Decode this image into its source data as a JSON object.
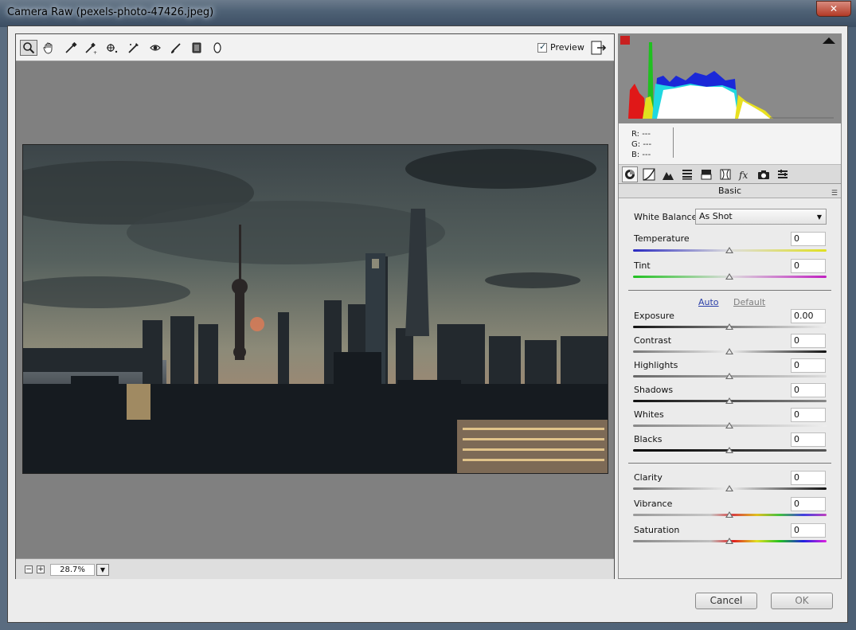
{
  "window": {
    "title": "Camera Raw (pexels-photo-47426.jpeg)",
    "close_glyph": "✕"
  },
  "toolbar": {
    "tools": [
      "zoom-icon",
      "hand-icon",
      "white-balance-icon",
      "color-sampler-icon",
      "targeted-adjust-icon",
      "crop-icon",
      "red-eye-icon",
      "brush-icon",
      "graduated-filter-icon",
      "radial-filter-icon"
    ],
    "preview_label": "Preview",
    "preview_checked": true
  },
  "zoom": {
    "minus": "−",
    "plus": "+",
    "value": "28.7%",
    "dropdown": "▼"
  },
  "readout": {
    "r_label": "R:",
    "r_value": "---",
    "g_label": "G:",
    "g_value": "---",
    "b_label": "B:",
    "b_value": "---"
  },
  "panel": {
    "tabs": [
      "basic-icon",
      "tone-curve-icon",
      "detail-icon",
      "hsl-icon",
      "split-toning-icon",
      "lens-icon",
      "fx-icon",
      "camera-calibration-icon",
      "presets-icon"
    ],
    "header": "Basic",
    "menu_glyph": "☰",
    "white_balance_label": "White Balance:",
    "white_balance_value": "As Shot",
    "auto_label": "Auto",
    "default_label": "Default",
    "sliders": [
      {
        "label": "Temperature",
        "value": "0",
        "position": 0.5
      },
      {
        "label": "Tint",
        "value": "0",
        "position": 0.5
      },
      {
        "label": "Exposure",
        "value": "0.00",
        "position": 0.5
      },
      {
        "label": "Contrast",
        "value": "0",
        "position": 0.5
      },
      {
        "label": "Highlights",
        "value": "0",
        "position": 0.5
      },
      {
        "label": "Shadows",
        "value": "0",
        "position": 0.5
      },
      {
        "label": "Whites",
        "value": "0",
        "position": 0.5
      },
      {
        "label": "Blacks",
        "value": "0",
        "position": 0.5
      },
      {
        "label": "Clarity",
        "value": "0",
        "position": 0.5
      },
      {
        "label": "Vibrance",
        "value": "0",
        "position": 0.5
      },
      {
        "label": "Saturation",
        "value": "0",
        "position": 0.5
      }
    ]
  },
  "buttons": {
    "cancel": "Cancel",
    "ok": "OK"
  },
  "colors": {
    "histogram_bg": "#8a8a8a",
    "link_blue": "#2b3fa8",
    "canvas_gray": "#808080"
  }
}
